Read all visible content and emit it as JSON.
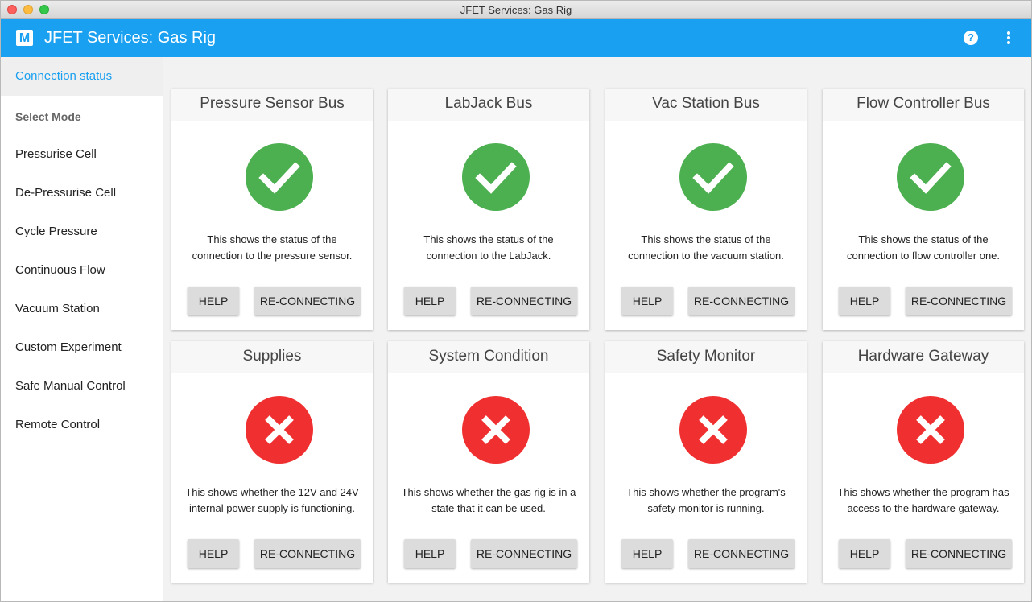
{
  "window": {
    "title": "JFET Services: Gas Rig"
  },
  "appbar": {
    "logo_letter": "M",
    "title": "JFET Services: Gas Rig",
    "help_icon": "question-mark-icon",
    "menu_icon": "more-vert-icon"
  },
  "sidebar": {
    "items": [
      {
        "label": "Connection status",
        "active": true
      },
      {
        "label": "Select Mode",
        "header": true
      },
      {
        "label": "Pressurise Cell"
      },
      {
        "label": "De-Pressurise Cell"
      },
      {
        "label": "Cycle Pressure"
      },
      {
        "label": "Continuous Flow"
      },
      {
        "label": "Vacuum Station"
      },
      {
        "label": "Custom Experiment"
      },
      {
        "label": "Safe Manual Control"
      },
      {
        "label": "Remote Control"
      }
    ]
  },
  "colors": {
    "accent": "#1aa0f0",
    "ok": "#4caf50",
    "error": "#f03030"
  },
  "cards": [
    {
      "title": "Pressure Sensor Bus",
      "status": "ok",
      "desc1": "This shows the status of the",
      "desc2": "connection to the pressure sensor.",
      "help_label": "HELP",
      "action_label": "RE-CONNECTING"
    },
    {
      "title": "LabJack Bus",
      "status": "ok",
      "desc1": "This shows the status of the",
      "desc2": "connection to the LabJack.",
      "help_label": "HELP",
      "action_label": "RE-CONNECTING"
    },
    {
      "title": "Vac Station Bus",
      "status": "ok",
      "desc1": "This shows the status of the",
      "desc2": "connection to the vacuum station.",
      "help_label": "HELP",
      "action_label": "RE-CONNECTING"
    },
    {
      "title": "Flow Controller Bus",
      "status": "ok",
      "desc1": "This shows the status of the",
      "desc2": "connection to flow controller one.",
      "help_label": "HELP",
      "action_label": "RE-CONNECTING"
    },
    {
      "title": "Supplies",
      "status": "error",
      "desc1": "This shows whether the 12V and 24V",
      "desc2": "internal power supply is functioning.",
      "help_label": "HELP",
      "action_label": "RE-CONNECTING"
    },
    {
      "title": "System Condition",
      "status": "error",
      "desc1": "This shows whether the gas rig is in a",
      "desc2": "state that it can be used.",
      "help_label": "HELP",
      "action_label": "RE-CONNECTING"
    },
    {
      "title": "Safety Monitor",
      "status": "error",
      "desc1": "This shows whether the program's",
      "desc2": "safety monitor is running.",
      "help_label": "HELP",
      "action_label": "RE-CONNECTING"
    },
    {
      "title": "Hardware Gateway",
      "status": "error",
      "desc1": "This shows whether the program has",
      "desc2": "access to the hardware gateway.",
      "help_label": "HELP",
      "action_label": "RE-CONNECTING"
    }
  ]
}
